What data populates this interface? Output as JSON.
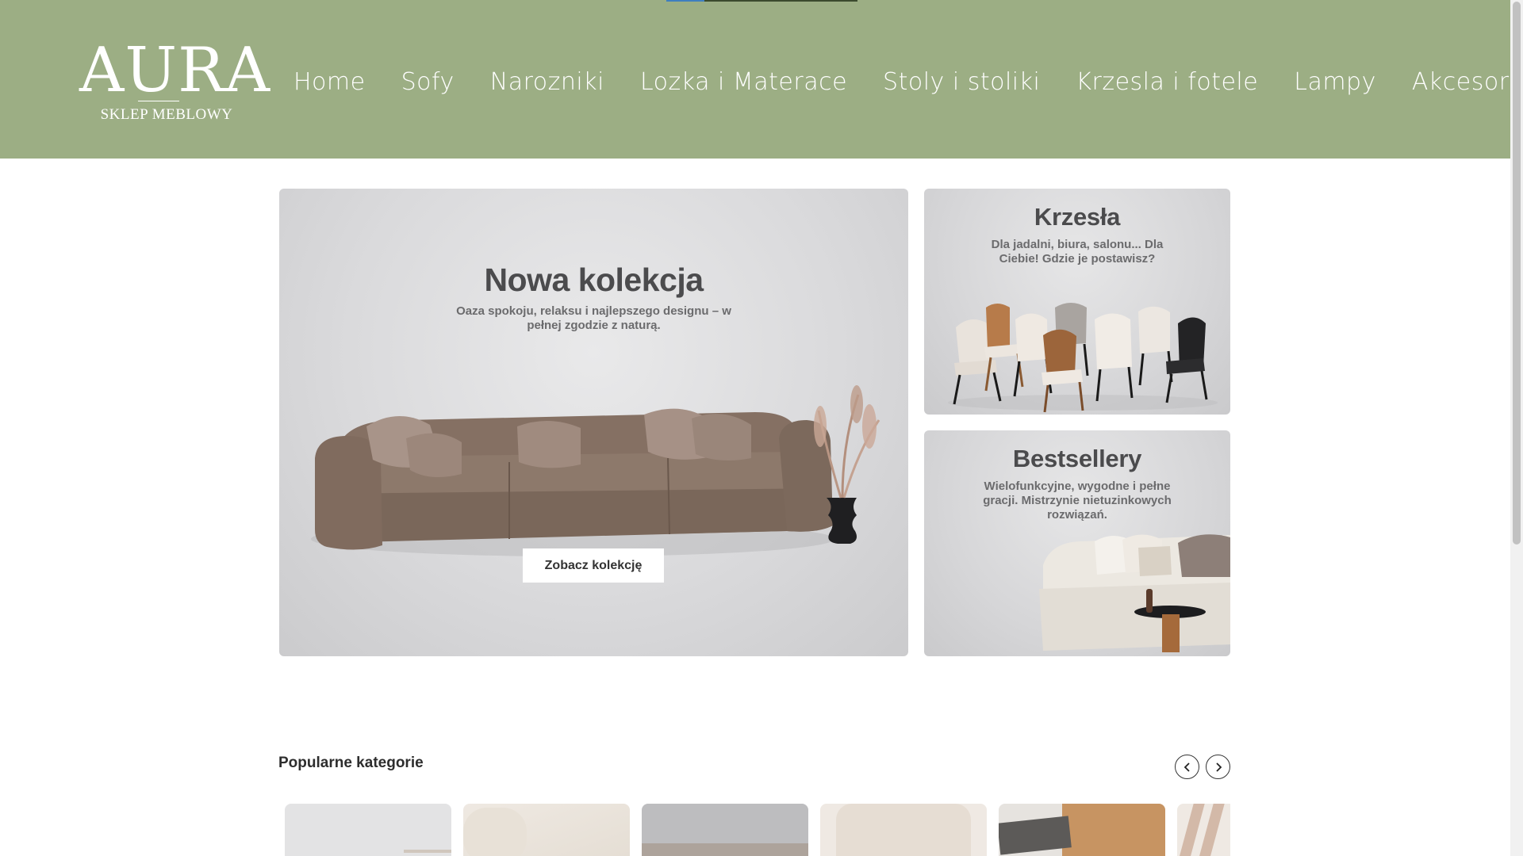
{
  "header": {
    "logo": {
      "word": "AURA",
      "subtitle": "SKLEP MEBLOWY"
    },
    "nav": [
      {
        "label": "Home"
      },
      {
        "label": "Sofy"
      },
      {
        "label": "Narozniki"
      },
      {
        "label": "Lozka i Materace"
      },
      {
        "label": "Stoly i stoliki"
      },
      {
        "label": "Krzesla i fotele"
      },
      {
        "label": "Lampy"
      },
      {
        "label": "Akcesoria"
      }
    ],
    "colors": {
      "background": "#9cae84",
      "text": "#ffffff"
    }
  },
  "hero": {
    "main": {
      "title": "Nowa kolekcja",
      "subtitle": "Oaza spokoju, relaksu i najlepszego designu – w pełnej zgodzie z naturą.",
      "button_label": "Zobacz kolekcję"
    },
    "cards": [
      {
        "title": "Krzesła",
        "subtitle": "Dla jadalni, biura, salonu... Dla Ciebie! Gdzie je postawisz?"
      },
      {
        "title": "Bestsellery",
        "subtitle": "Wielofunkcyjne, wygodne i pełne gracji. Mistrzynie nietuzinkowych rozwiązań."
      }
    ]
  },
  "popular": {
    "title": "Popularne kategorie",
    "prev_icon": "chevron-left-icon",
    "next_icon": "chevron-right-icon"
  }
}
